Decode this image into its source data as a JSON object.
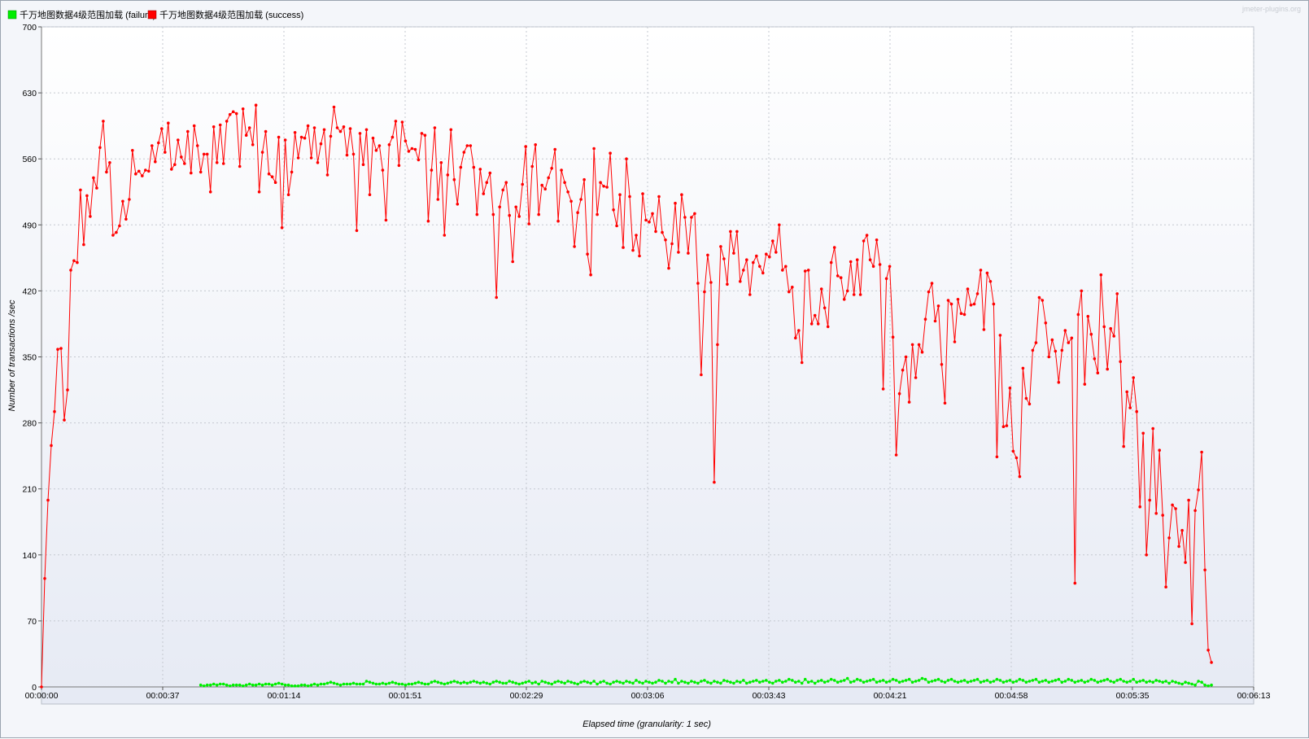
{
  "chart_data": {
    "type": "line",
    "xlabel": "Elapsed time (granularity: 1 sec)",
    "ylabel": "Number of transactions /sec",
    "watermark": "jmeter-plugins.org",
    "legend_placement": "top-left",
    "grid": true,
    "ylim": [
      0,
      700
    ],
    "y_ticks": [
      "0",
      "70",
      "140",
      "210",
      "280",
      "350",
      "420",
      "490",
      "560",
      "630",
      "700"
    ],
    "x_ticks": [
      "00:00:00",
      "00:00:37",
      "00:01:14",
      "00:01:51",
      "00:02:29",
      "00:03:06",
      "00:03:43",
      "00:04:21",
      "00:04:58",
      "00:05:35",
      "00:06:13"
    ],
    "xlim_seconds": [
      0,
      373
    ],
    "series": [
      {
        "name": "千万地图数据4级范围加载 (failure)",
        "color": "#00ee00",
        "x_start": 49,
        "values": [
          2,
          1,
          2,
          2,
          3,
          2,
          3,
          3,
          2,
          1,
          2,
          2,
          2,
          1,
          2,
          3,
          2,
          2,
          3,
          2,
          3,
          3,
          2,
          3,
          4,
          3,
          2,
          2,
          1,
          1,
          1,
          2,
          2,
          1,
          2,
          3,
          2,
          3,
          3,
          4,
          5,
          4,
          3,
          2,
          3,
          3,
          3,
          4,
          3,
          3,
          3,
          6,
          5,
          4,
          3,
          3,
          4,
          3,
          4,
          5,
          4,
          3,
          3,
          2,
          3,
          3,
          4,
          5,
          4,
          3,
          3,
          5,
          6,
          5,
          4,
          3,
          4,
          5,
          6,
          5,
          4,
          5,
          4,
          5,
          6,
          5,
          4,
          5,
          4,
          3,
          5,
          6,
          5,
          4,
          4,
          6,
          5,
          4,
          3,
          4,
          5,
          6,
          4,
          5,
          3,
          6,
          5,
          4,
          3,
          5,
          6,
          5,
          4,
          6,
          5,
          4,
          3,
          5,
          6,
          5,
          4,
          6,
          3,
          5,
          6,
          4,
          3,
          5,
          6,
          5,
          4,
          6,
          5,
          4,
          7,
          5,
          4,
          6,
          5,
          4,
          5,
          7,
          6,
          4,
          6,
          5,
          8,
          4,
          6,
          5,
          4,
          6,
          5,
          4,
          6,
          7,
          5,
          4,
          6,
          5,
          4,
          7,
          6,
          5,
          4,
          6,
          5,
          7,
          4,
          5,
          6,
          7,
          5,
          6,
          7,
          5,
          4,
          6,
          7,
          5,
          6,
          8,
          7,
          5,
          6,
          4,
          8,
          5,
          6,
          4,
          6,
          7,
          5,
          6,
          8,
          7,
          5,
          6,
          7,
          9,
          5,
          6,
          8,
          7,
          5,
          6,
          7,
          8,
          5,
          6,
          7,
          5,
          6,
          8,
          7,
          5,
          6,
          7,
          8,
          5,
          6,
          7,
          9,
          8,
          5,
          6,
          7,
          8,
          6,
          5,
          7,
          8,
          6,
          5,
          6,
          7,
          5,
          6,
          7,
          8,
          5,
          6,
          7,
          5,
          6,
          8,
          7,
          5,
          6,
          7,
          5,
          6,
          8,
          7,
          5,
          6,
          7,
          8,
          5,
          6,
          7,
          5,
          6,
          7,
          8,
          5,
          6,
          8,
          7,
          5,
          6,
          7,
          5,
          6,
          8,
          7,
          5,
          6,
          7,
          8,
          6,
          5,
          7,
          8,
          6,
          5,
          6,
          8,
          5,
          6,
          7,
          5,
          6,
          5,
          7,
          6,
          5,
          6,
          4,
          6,
          5,
          4,
          3,
          5,
          4,
          3,
          2,
          6,
          5,
          2,
          1,
          2
        ]
      },
      {
        "name": "千万地图数据4级范围加载 (success)",
        "color": "#ff0000",
        "x_start": 0,
        "values": [
          0,
          115,
          198,
          256,
          292,
          358,
          359,
          283,
          315,
          442,
          452,
          450,
          527,
          469,
          521,
          499,
          540,
          529,
          572,
          600,
          546,
          556,
          479,
          482,
          489,
          515,
          496,
          517,
          569,
          544,
          547,
          542,
          548,
          547,
          574,
          557,
          577,
          592,
          567,
          598,
          549,
          554,
          580,
          562,
          555,
          589,
          545,
          595,
          574,
          546,
          565,
          565,
          525,
          594,
          556,
          596,
          555,
          600,
          607,
          610,
          608,
          552,
          613,
          585,
          593,
          575,
          617,
          525,
          567,
          589,
          544,
          541,
          535,
          583,
          487,
          580,
          522,
          546,
          588,
          561,
          583,
          582,
          595,
          561,
          593,
          556,
          576,
          591,
          543,
          584,
          615,
          593,
          589,
          594,
          564,
          592,
          565,
          484,
          587,
          554,
          591,
          522,
          582,
          569,
          574,
          548,
          495,
          575,
          583,
          600,
          553,
          599,
          579,
          568,
          571,
          570,
          559,
          587,
          585,
          494,
          548,
          593,
          517,
          556,
          479,
          543,
          591,
          538,
          512,
          551,
          567,
          574,
          574,
          551,
          501,
          549,
          523,
          535,
          545,
          501,
          413,
          509,
          527,
          535,
          500,
          451,
          509,
          499,
          533,
          573,
          491,
          552,
          575,
          501,
          532,
          528,
          540,
          550,
          570,
          494,
          548,
          535,
          525,
          515,
          467,
          503,
          517,
          538,
          459,
          437,
          571,
          501,
          535,
          531,
          530,
          566,
          506,
          489,
          522,
          466,
          560,
          520,
          463,
          479,
          457,
          523,
          495,
          493,
          502,
          483,
          520,
          482,
          474,
          444,
          470,
          513,
          461,
          522,
          498,
          460,
          498,
          502,
          428,
          331,
          419,
          458,
          429,
          217,
          363,
          467,
          454,
          427,
          483,
          460,
          483,
          430,
          442,
          453,
          416,
          450,
          457,
          446,
          439,
          459,
          456,
          473,
          461,
          490,
          442,
          446,
          419,
          424,
          370,
          378,
          344,
          441,
          442,
          385,
          394,
          385,
          422,
          402,
          382,
          450,
          466,
          436,
          434,
          411,
          420,
          451,
          416,
          453,
          416,
          473,
          479,
          453,
          446,
          474,
          448,
          316,
          433,
          446,
          371,
          246,
          311,
          336,
          350,
          302,
          363,
          328,
          363,
          355,
          390,
          419,
          428,
          388,
          404,
          342,
          301,
          410,
          406,
          366,
          411,
          396,
          395,
          422,
          405,
          406,
          417,
          442,
          379,
          439,
          430,
          406,
          244,
          373,
          276,
          277,
          317,
          250,
          243,
          223,
          338,
          306,
          300,
          357,
          365,
          413,
          410,
          386,
          350,
          368,
          356,
          323,
          357,
          378,
          365,
          370,
          110,
          395,
          420,
          321,
          393,
          374,
          348,
          333,
          437,
          382,
          337,
          380,
          372,
          417,
          345,
          255,
          313,
          296,
          328,
          292,
          191,
          269,
          140,
          198,
          274,
          184,
          251,
          182,
          106,
          158,
          193,
          189,
          149,
          166,
          132,
          198,
          67,
          187,
          209,
          249,
          124,
          39,
          26
        ]
      }
    ]
  }
}
